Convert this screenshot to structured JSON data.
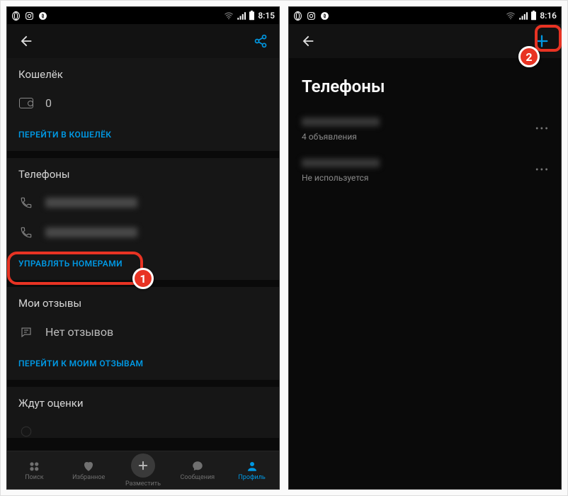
{
  "statusbar": {
    "time_left": "8:15",
    "time_right": "8:16"
  },
  "left_phone": {
    "wallet": {
      "header": "Кошелёк",
      "balance": "0",
      "link": "ПЕРЕЙТИ В КОШЕЛЁК"
    },
    "phones": {
      "header": "Телефоны",
      "link": "УПРАВЛЯТЬ НОМЕРАМИ"
    },
    "reviews": {
      "header": "Мои отзывы",
      "empty": "Нет отзывов",
      "link": "ПЕРЕЙТИ К МОИМ ОТЗЫВАМ"
    },
    "pending": {
      "header": "Ждут оценки"
    }
  },
  "right_phone": {
    "title": "Телефоны",
    "items": [
      {
        "sub": "4 объявления"
      },
      {
        "sub": "Не используется"
      }
    ]
  },
  "nav": {
    "search": "Поиск",
    "fav": "Избранное",
    "post": "Разместить",
    "msg": "Сообщения",
    "profile": "Профиль"
  },
  "callouts": {
    "one": "1",
    "two": "2"
  }
}
